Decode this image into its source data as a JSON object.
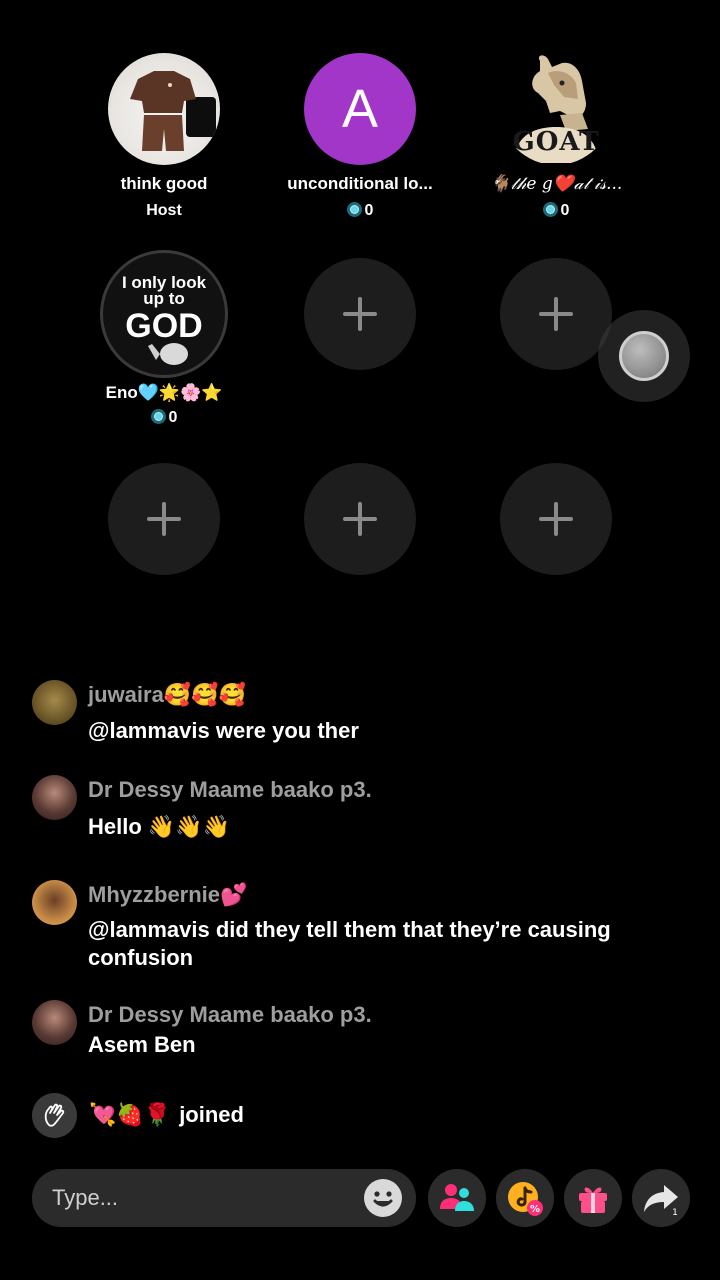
{
  "seats": [
    {
      "name": "think good",
      "role": "Host"
    },
    {
      "name": "unconditional lo...",
      "letter": "A",
      "coins": "0"
    },
    {
      "name": "🐐𝓉𝒽𝑒 g❤️𝒶𝓉 𝒾𝓈...",
      "coins": "0",
      "avatar_text": "GOAT"
    },
    {
      "name": "Eno🩵🌟🌸⭐",
      "coins": "0",
      "avatar_text_1": "I only look",
      "avatar_text_2": "up to",
      "avatar_text_3": "GOD"
    }
  ],
  "chat": [
    {
      "user": "juwaira🥰🥰🥰",
      "text": "@lammavis were you ther"
    },
    {
      "user": "Dr Dessy Maame baako p3.",
      "text": "Hello 👋👋👋"
    },
    {
      "user": "Mhyzzbernie💕",
      "text": "@lammavis did they tell them that they’re causing confusion"
    },
    {
      "user": "Dr Dessy Maame baako p3.",
      "text": "Asem Ben"
    }
  ],
  "join": {
    "user": "💘🍓🌹",
    "text": "joined"
  },
  "input": {
    "placeholder": "Type..."
  },
  "icons": {
    "add_seat": "plus-icon",
    "coin": "coin-icon",
    "emoji": "smiley-icon",
    "guests": "people-icon",
    "promo": "tiktok-coupon-icon",
    "gift": "gift-icon",
    "share": "share-arrow-icon",
    "wave": "wave-hand-icon"
  },
  "colors": {
    "background": "#000000",
    "letter_avatar": "#a136c8",
    "guests_icon": "#ff2e78",
    "guests_icon_2": "#2ee0dc",
    "gift": "#ff4f8b",
    "promo": "#ffb020"
  }
}
